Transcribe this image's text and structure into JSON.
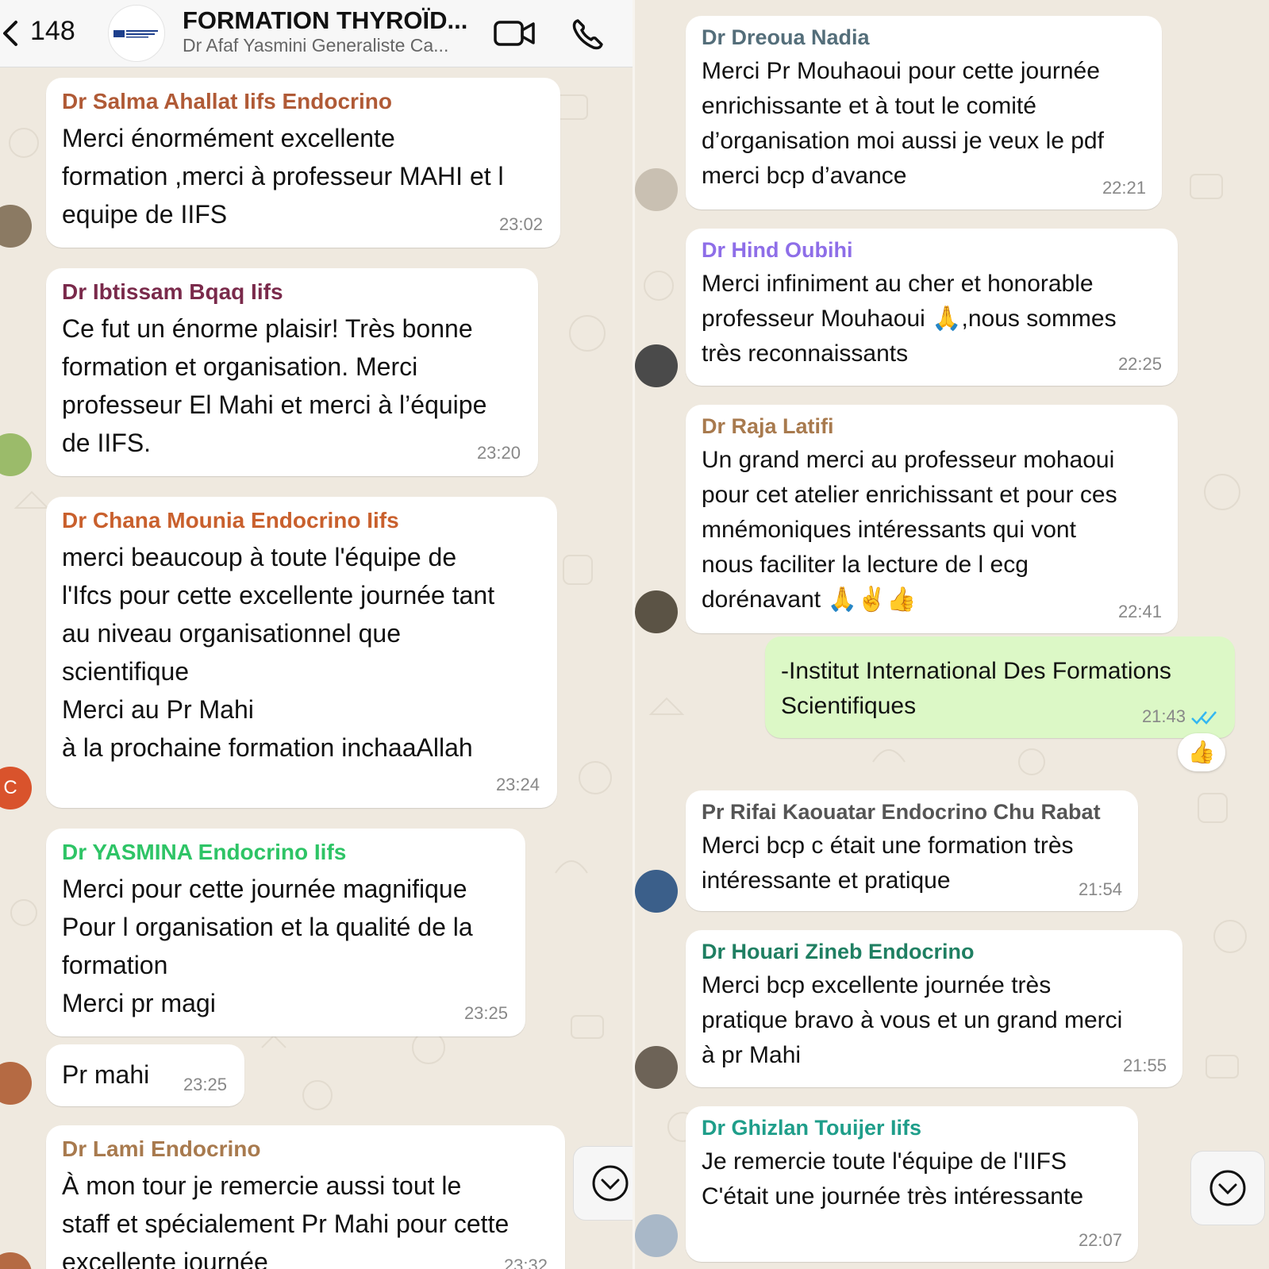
{
  "header": {
    "back_count": "148",
    "title": "FORMATION THYROÏD...",
    "subtitle": "Dr Afaf Yasmini Generaliste Ca...",
    "video_icon": "video-camera-icon",
    "call_icon": "phone-icon"
  },
  "left_messages": [
    {
      "sender": "Dr Salma Ahallat Iifs Endocrino",
      "text": "Merci énormément excellente\nformation ,merci à professeur MAHI et l\nequipe de IIFS",
      "time": "23:02"
    },
    {
      "sender": "Dr Ibtissam Bqaq Iifs",
      "text": "Ce fut un énorme plaisir! Très bonne\nformation et organisation. Merci\nprofesseur El Mahi et merci à l’équipe\nde IIFS.",
      "time": "23:20"
    },
    {
      "sender": "Dr Chana Mounia Endocrino Iifs",
      "text": "merci beaucoup à toute l'équipe de\nl'Ifcs pour cette excellente journée tant\nau niveau organisationnel que\nscientifique\nMerci au Pr Mahi\nà la prochaine formation inchaaAllah",
      "time": "23:24",
      "avatar_letter": "C"
    },
    {
      "sender": "Dr YASMINA Endocrino Iifs",
      "text": "Merci pour cette journée magnifique\nPour l organisation et la qualité de la\nformation\nMerci pr magi",
      "time": "23:25"
    },
    {
      "text": "Pr mahi",
      "time": "23:25"
    },
    {
      "sender": "Dr Lami Endocrino",
      "text": "À mon tour je remercie aussi tout le\nstaff et spécialement Pr Mahi pour cette\nexcellente journée",
      "time": "23:32"
    }
  ],
  "right_messages": [
    {
      "sender": "Dr Dreoua Nadia",
      "text": "Merci Pr Mouhaoui pour cette journée\nenrichissante et à tout le comité\nd’organisation moi aussi je veux le pdf\nmerci bcp d’avance",
      "time": "22:21"
    },
    {
      "sender": "Dr Hind Oubihi",
      "text_lines": [
        "Merci infiniment au cher et honorable",
        "professeur Mouhaoui ",
        ",nous sommes",
        "très reconnaissants"
      ],
      "emoji": "🙏",
      "time": "22:25"
    },
    {
      "sender": "Dr Raja Latifi",
      "text": "Un grand merci au professeur mohaoui\npour cet atelier enrichissant et pour ces\nmnémoniques intéressants qui vont\nnous faciliter la lecture de l ecg",
      "last_line": "dorénavant ",
      "emojis": "🙏✌️👍",
      "time": "22:41"
    },
    {
      "text": "-Institut International Des Formations\nScientifiques",
      "time": "21:43",
      "outgoing": true,
      "reaction": "👍"
    },
    {
      "sender": "Pr Rifai Kaouatar Endocrino Chu Rabat",
      "text": "Merci bcp c était une formation très\nintéressante et pratique",
      "time": "21:54"
    },
    {
      "sender": "Dr Houari Zineb Endocrino",
      "text": "Merci bcp excellente journée très\npratique bravo à vous et un grand merci\nà pr Mahi",
      "time": "21:55"
    },
    {
      "sender": "Dr Ghizlan Touijer Iifs",
      "text": "Je remercie toute l'équipe de l'IIFS\nC'était une journée très intéressante",
      "time": "22:07"
    }
  ],
  "colors": {
    "wallpaper": "#efe9df",
    "incoming": "#ffffff",
    "outgoing": "#dcf8c6",
    "read_ticks": "#34b7f1"
  },
  "sender_colors": [
    "#b05a36",
    "#7a2a4b",
    "#c9602d",
    "#2ec466",
    "#a87a4e",
    "#546e7a",
    "#8e6ee8",
    "#a87a4e",
    "#555555",
    "#1f7f62",
    "#1f9e8a"
  ],
  "scroll_icon": "chevron-down-icon"
}
